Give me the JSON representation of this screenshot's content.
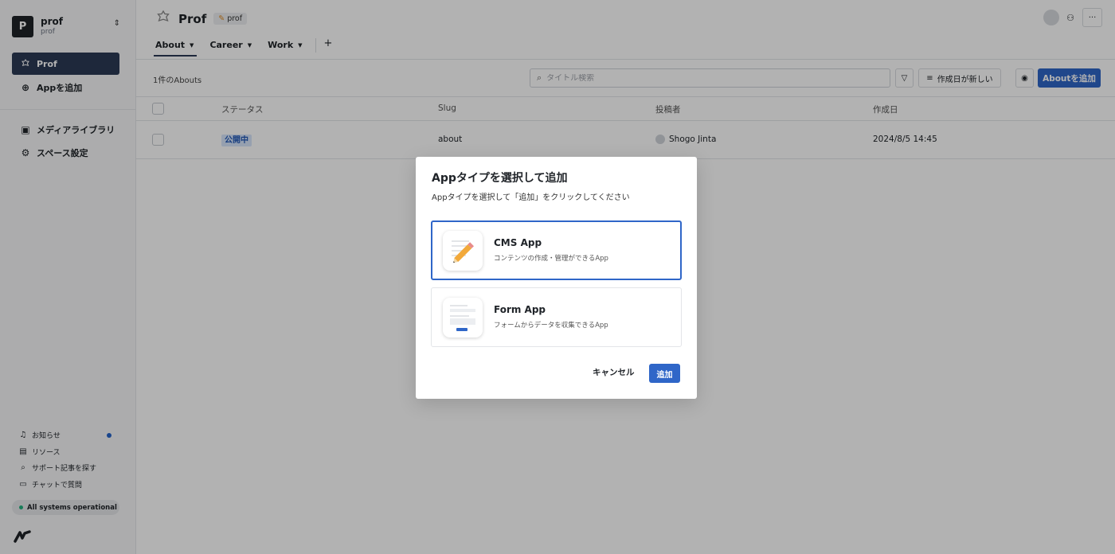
{
  "sidebar": {
    "space": {
      "avatar_letter": "P",
      "name": "prof",
      "sub": "prof"
    },
    "nav": [
      {
        "label": "Prof",
        "icon": "app-gear-icon",
        "active": true
      },
      {
        "label": "Appを追加",
        "icon": "plus-circle-icon"
      }
    ],
    "nav2": [
      {
        "label": "メディアライブラリ",
        "icon": "image-icon"
      },
      {
        "label": "スペース設定",
        "icon": "gear-icon"
      }
    ],
    "footer": [
      {
        "label": "お知らせ",
        "icon": "bell-icon"
      },
      {
        "label": "リソース",
        "icon": "book-icon"
      },
      {
        "label": "サポート記事を探す",
        "icon": "search-icon"
      },
      {
        "label": "チャットで質問",
        "icon": "chat-icon"
      }
    ],
    "status": "All systems operational"
  },
  "header": {
    "title": "Prof",
    "badge": "prof",
    "tabs": [
      {
        "label": "About",
        "active": true
      },
      {
        "label": "Career"
      },
      {
        "label": "Work"
      }
    ],
    "add_tab": "+"
  },
  "toolbar": {
    "count": "1件のAbouts",
    "search_placeholder": "タイトル検索",
    "sort_label": "作成日が新しい",
    "add_label": "Aboutを追加"
  },
  "table": {
    "columns": [
      "ステータス",
      "Slug",
      "投稿者",
      "作成日"
    ],
    "rows": [
      {
        "status": "公開中",
        "slug": "about",
        "author": "Shogo Jinta",
        "created": "2024/8/5 14:45"
      }
    ]
  },
  "modal": {
    "title": "Appタイプを選択して追加",
    "description": "Appタイプを選択して「追加」をクリックしてください",
    "options": [
      {
        "name": "CMS App",
        "desc": "コンテンツの作成・管理ができるApp",
        "selected": true
      },
      {
        "name": "Form App",
        "desc": "フォームからデータを収集できるApp",
        "selected": false
      }
    ],
    "cancel": "キャンセル",
    "confirm": "追加"
  },
  "colors": {
    "primary": "#2f66c8",
    "sidebar_active": "#2b3a55",
    "status_green": "#22b07d"
  }
}
